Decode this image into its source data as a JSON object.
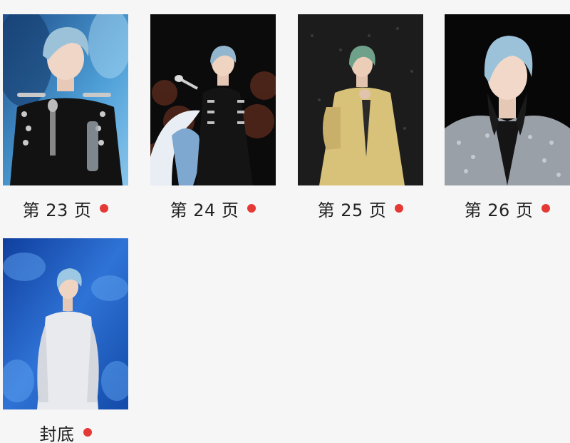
{
  "pages": [
    {
      "label": "第 23 页",
      "icon": "red-dot-icon",
      "photo": "performer-black-jacket-microphone"
    },
    {
      "label": "第 24 页",
      "icon": "red-dot-icon",
      "photo": "performer-black-jacket-wave-stage"
    },
    {
      "label": "第 25 页",
      "icon": "red-dot-icon",
      "photo": "performer-gold-suit"
    },
    {
      "label": "第 26 页",
      "icon": "red-dot-icon",
      "photo": "performer-sequin-jacket"
    },
    {
      "label": "封底",
      "icon": "red-dot-icon",
      "photo": "performer-white-suit-blue-stage"
    }
  ],
  "colors": {
    "background": "#f6f6f6",
    "dot": "#e53935",
    "text": "#222222"
  }
}
